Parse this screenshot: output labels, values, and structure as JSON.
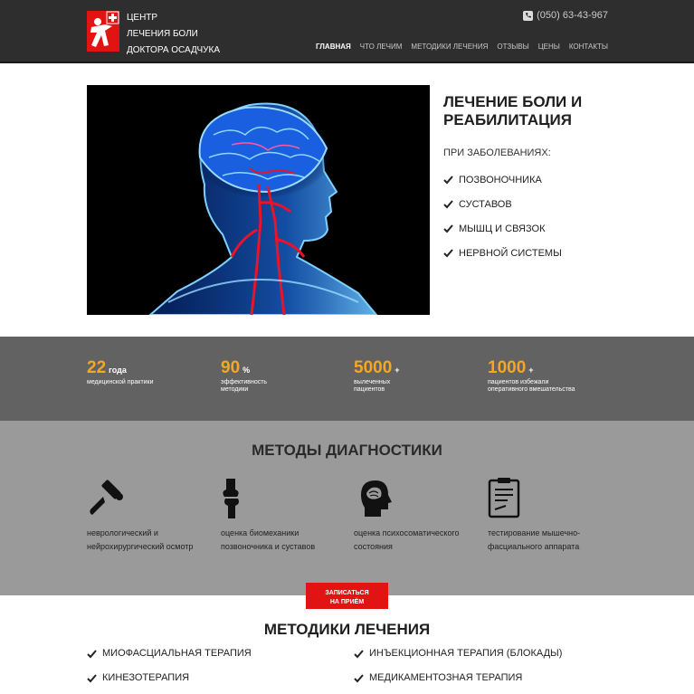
{
  "header": {
    "brand_line1": "ЦЕНТР",
    "brand_line2": "ЛЕЧЕНИЯ БОЛИ",
    "brand_line3": "ДОКТОРА ОСАДЧУКА",
    "phone": "(050) 63-43-967",
    "nav": [
      "ГЛАВНАЯ",
      "ЧТО ЛЕЧИМ",
      "МЕТОДИКИ ЛЕЧЕНИЯ",
      "ОТЗЫВЫ",
      "ЦЕНЫ",
      "КОНТАКТЫ"
    ]
  },
  "hero": {
    "title": "ЛЕЧЕНИЕ БОЛИ И РЕАБИЛИТАЦИЯ",
    "subtitle": "ПРИ ЗАБОЛЕВАНИЯХ:",
    "items": [
      "ПОЗВОНОЧНИКА",
      "СУСТАВОВ",
      "МЫШЦ И СВЯЗОК",
      "НЕРВНОЙ СИСТЕМЫ"
    ]
  },
  "stats": [
    {
      "num": "22",
      "unit": "года",
      "desc": "медицинской практики"
    },
    {
      "num": "90",
      "unit": "%",
      "desc": "эффективность методики"
    },
    {
      "num": "5000",
      "unit": "+",
      "desc": "вылеченных пациентов"
    },
    {
      "num": "1000",
      "unit": "+",
      "desc": "пациентов избежали оперативного вмешательства"
    }
  ],
  "diagnostics": {
    "title": "МЕТОДЫ ДИАГНОСТИКИ",
    "items": [
      {
        "icon": "reflex-hammer-icon",
        "text": "неврологический и нейрохирургический осмотр"
      },
      {
        "icon": "knee-joint-icon",
        "text": "оценка биомеханики позвоночника и суставов"
      },
      {
        "icon": "head-profile-icon",
        "text": "оценка психосоматического состояния"
      },
      {
        "icon": "clipboard-icon",
        "text": "тестирование мышечно-фасциального аппарата"
      }
    ]
  },
  "cta": {
    "line1": "ЗАПИСАТЬСЯ",
    "line2": "НА ПРИЁМ"
  },
  "methods": {
    "title": "МЕТОДИКИ ЛЕЧЕНИЯ",
    "items": [
      "МИОФАСЦИАЛЬНАЯ ТЕРАПИЯ",
      "ИНЪЕКЦИОННАЯ ТЕРАПИЯ (БЛОКАДЫ)",
      "КИНЕЗОТЕРАПИЯ",
      "МЕДИКАМЕНТОЗНАЯ ТЕРАПИЯ"
    ]
  },
  "colors": {
    "accent": "#f5a623",
    "cta": "#e11313",
    "header": "#2e2e2e"
  }
}
